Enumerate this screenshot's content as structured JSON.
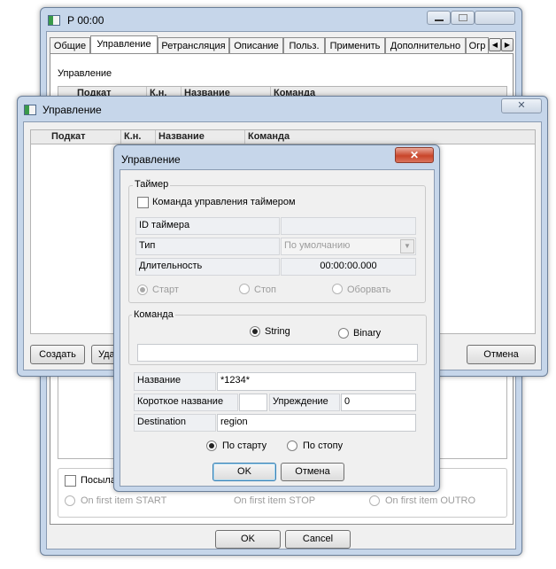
{
  "back_window": {
    "title": "Р 00:00",
    "tabs": [
      "Общие",
      "Управление",
      "Ретрансляция",
      "Описание",
      "Польз.",
      "Применить",
      "Дополнительно",
      "Огр"
    ],
    "section_label": "Управление",
    "columns": [
      "Подкат",
      "К.н.",
      "Название",
      "Команда"
    ],
    "send_checkbox_label": "Посылат",
    "radio_options": [
      "On first item START",
      "On first item STOP",
      "On first item OUTRO"
    ],
    "ok_label": "OK",
    "cancel_label": "Cancel"
  },
  "mid_window": {
    "title": "Управление",
    "columns": [
      "Подкат",
      "К.н.",
      "Название",
      "Команда"
    ],
    "create_label": "Создать",
    "delete_label_partial": "Уда",
    "cancel_label": "Отмена"
  },
  "dialog": {
    "title": "Управление",
    "close_glyph": "✕",
    "timer": {
      "legend": "Таймер",
      "checkbox_label": "Команда управления таймером",
      "id_label": "ID таймера",
      "id_value": "",
      "type_label": "Тип",
      "type_value": "По умолчанию",
      "duration_label": "Длительность",
      "duration_value": "00:00:00.000",
      "actions": [
        "Старт",
        "Стоп",
        "Оборвать"
      ]
    },
    "command": {
      "legend": "Команда",
      "string_label": "String",
      "binary_label": "Binary",
      "value": ""
    },
    "name_label": "Название",
    "name_value": "*1234*",
    "short_name_label": "Короткое название",
    "short_name_value": "",
    "advance_label": "Упреждение",
    "advance_value": "0",
    "destination_label": "Destination",
    "destination_value": "region",
    "start_option": "По старту",
    "stop_option": "По стопу",
    "ok_label": "OK",
    "cancel_label": "Отмена"
  }
}
